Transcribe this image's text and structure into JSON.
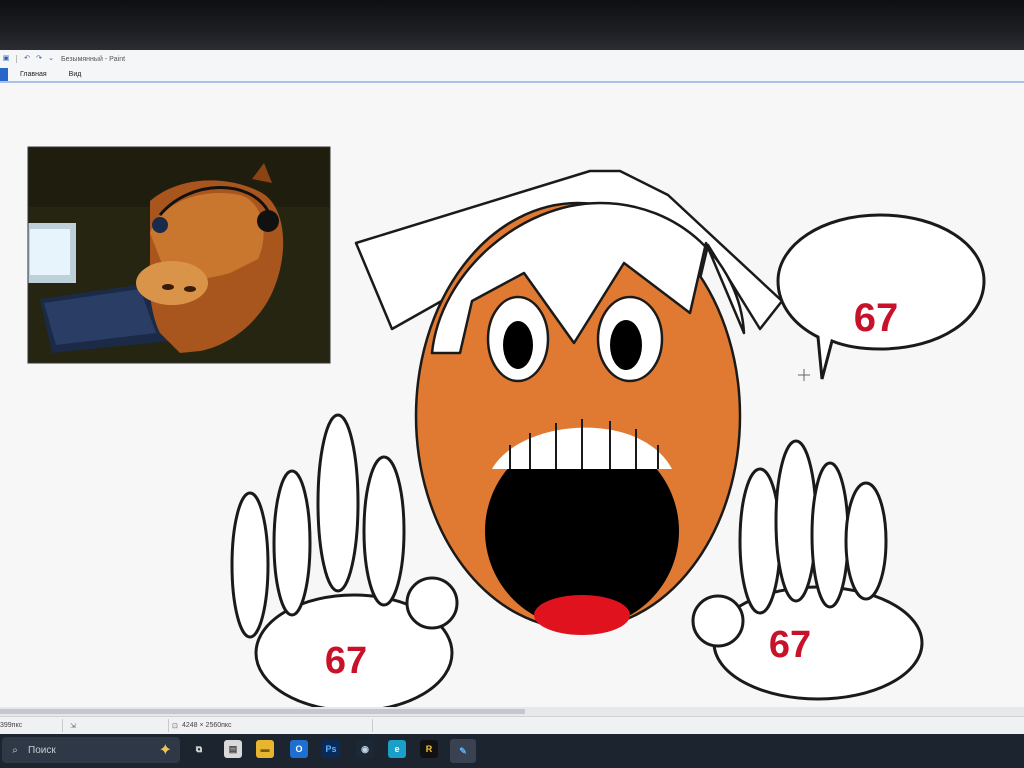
{
  "window": {
    "title": "Безымянный - Paint",
    "qat_icons": [
      "save-icon",
      "undo-icon",
      "redo-icon",
      "customize-chevron-icon"
    ],
    "qat_glyphs": [
      "▣",
      "↶",
      "↷",
      "⌄"
    ]
  },
  "menu": {
    "tabs": [
      {
        "label": "Главная"
      },
      {
        "label": "Вид"
      }
    ]
  },
  "canvas": {
    "speech_bubble_text": "67",
    "left_hand_text": "67",
    "right_hand_text": "67",
    "colors": {
      "face": "#e07a32",
      "mouth": "#000000",
      "tongue": "#e0121e",
      "outline": "#1a1a1a",
      "number_text": "#c8122a"
    }
  },
  "status": {
    "cursor_pos": "399пкс",
    "selection_icon": "selection-size-icon",
    "canvas_size": "4248 × 2560пкс"
  },
  "taskbar": {
    "search_label": "Поиск",
    "apps": [
      {
        "name": "task-view-icon",
        "glyph": "⧉",
        "color": "#3a4252"
      },
      {
        "name": "store-icon",
        "glyph": "▤",
        "color": "#d9d9d9"
      },
      {
        "name": "file-explorer-icon",
        "glyph": "▬",
        "color": "#e8b52e"
      },
      {
        "name": "outlook-icon",
        "glyph": "O",
        "color": "#1f6fd1"
      },
      {
        "name": "photoshop-icon",
        "glyph": "Ps",
        "color": "#0a2a5a"
      },
      {
        "name": "steam-icon",
        "glyph": "◉",
        "color": "#1b2838"
      },
      {
        "name": "edge-icon",
        "glyph": "e",
        "color": "#1aa0c8"
      },
      {
        "name": "app-r-icon",
        "glyph": "R",
        "color": "#111111"
      },
      {
        "name": "paint-icon",
        "glyph": "✎",
        "color": "#3a8fd6"
      }
    ]
  }
}
